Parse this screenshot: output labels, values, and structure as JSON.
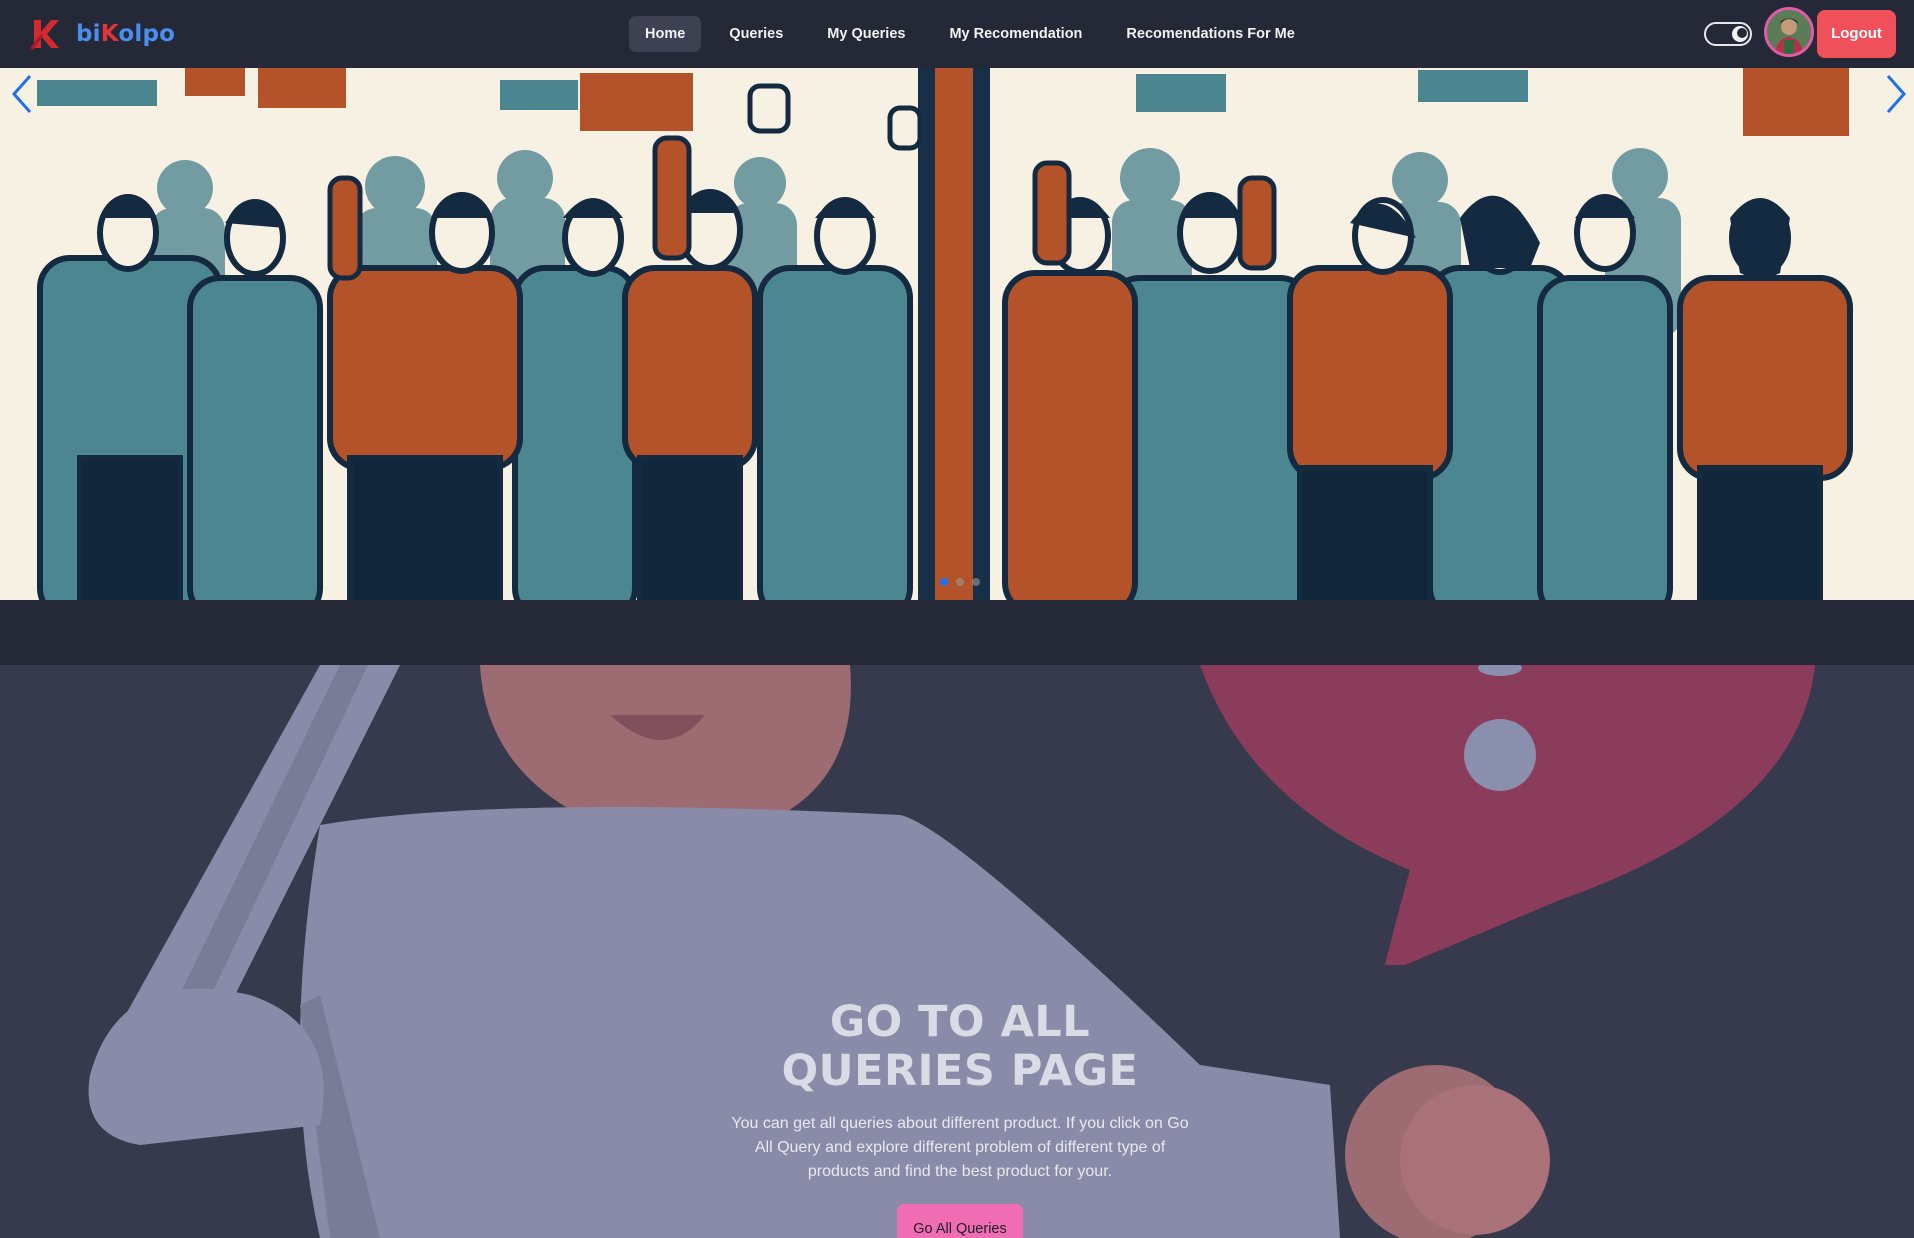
{
  "brand": {
    "name_part1": "bi",
    "name_part2": "K",
    "name_part3": "olpo",
    "logo_icon": "k-logo-icon"
  },
  "nav": {
    "items": [
      {
        "label": "Home",
        "active": true
      },
      {
        "label": "Queries",
        "active": false
      },
      {
        "label": "My Queries",
        "active": false
      },
      {
        "label": "My Recomendation",
        "active": false
      },
      {
        "label": "Recomendations For Me",
        "active": false
      }
    ]
  },
  "header_actions": {
    "theme_toggle_icon": "moon-toggle-icon",
    "logout_label": "Logout"
  },
  "carousel": {
    "slide_count": 3,
    "active_slide": 1,
    "prev_icon": "chevron-left-icon",
    "next_icon": "chevron-right-icon"
  },
  "cta": {
    "heading_line1": "GO TO ALL",
    "heading_line2": "QUERIES PAGE",
    "description": "You can get all queries about different product. If you click on Go All Query and explore different problem of different type of products and find the best product for your.",
    "button_label": "Go All Queries"
  },
  "colors": {
    "navbar_bg": "#252836",
    "logout": "#f0505a",
    "cta_button": "#f06cb3",
    "brand_blue": "#4a8ef0",
    "brand_red": "#e0343a"
  }
}
